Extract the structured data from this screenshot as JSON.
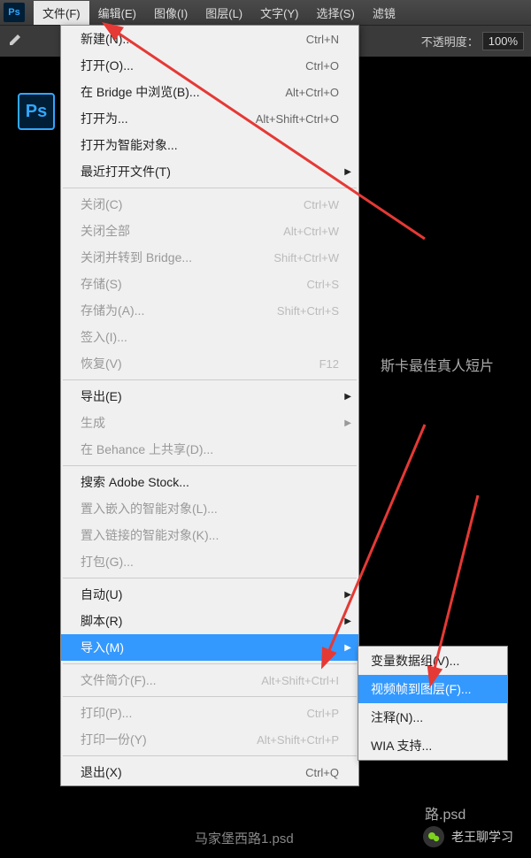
{
  "menubar": {
    "logo": "Ps",
    "items": [
      "文件(F)",
      "编辑(E)",
      "图像(I)",
      "图层(L)",
      "文字(Y)",
      "选择(S)",
      "滤镜"
    ]
  },
  "toolbar": {
    "opacity_label": "不透明度：",
    "opacity_value": "100%"
  },
  "side_logo": "Ps",
  "dropdown": [
    {
      "type": "item",
      "label": "新建(N)...",
      "shortcut": "Ctrl+N"
    },
    {
      "type": "item",
      "label": "打开(O)...",
      "shortcut": "Ctrl+O"
    },
    {
      "type": "item",
      "label": "在 Bridge 中浏览(B)...",
      "shortcut": "Alt+Ctrl+O"
    },
    {
      "type": "item",
      "label": "打开为...",
      "shortcut": "Alt+Shift+Ctrl+O"
    },
    {
      "type": "item",
      "label": "打开为智能对象..."
    },
    {
      "type": "item",
      "label": "最近打开文件(T)",
      "submenu": true
    },
    {
      "type": "sep"
    },
    {
      "type": "item",
      "label": "关闭(C)",
      "shortcut": "Ctrl+W",
      "disabled": true
    },
    {
      "type": "item",
      "label": "关闭全部",
      "shortcut": "Alt+Ctrl+W",
      "disabled": true
    },
    {
      "type": "item",
      "label": "关闭并转到 Bridge...",
      "shortcut": "Shift+Ctrl+W",
      "disabled": true
    },
    {
      "type": "item",
      "label": "存储(S)",
      "shortcut": "Ctrl+S",
      "disabled": true
    },
    {
      "type": "item",
      "label": "存储为(A)...",
      "shortcut": "Shift+Ctrl+S",
      "disabled": true
    },
    {
      "type": "item",
      "label": "签入(I)...",
      "disabled": true
    },
    {
      "type": "item",
      "label": "恢复(V)",
      "shortcut": "F12",
      "disabled": true
    },
    {
      "type": "sep"
    },
    {
      "type": "item",
      "label": "导出(E)",
      "submenu": true
    },
    {
      "type": "item",
      "label": "生成",
      "submenu": true,
      "disabled": true
    },
    {
      "type": "item",
      "label": "在 Behance 上共享(D)...",
      "disabled": true
    },
    {
      "type": "sep"
    },
    {
      "type": "item",
      "label": "搜索 Adobe Stock..."
    },
    {
      "type": "item",
      "label": "置入嵌入的智能对象(L)...",
      "disabled": true
    },
    {
      "type": "item",
      "label": "置入链接的智能对象(K)...",
      "disabled": true
    },
    {
      "type": "item",
      "label": "打包(G)...",
      "disabled": true
    },
    {
      "type": "sep"
    },
    {
      "type": "item",
      "label": "自动(U)",
      "submenu": true
    },
    {
      "type": "item",
      "label": "脚本(R)",
      "submenu": true
    },
    {
      "type": "item",
      "label": "导入(M)",
      "submenu": true,
      "highlighted": true
    },
    {
      "type": "sep"
    },
    {
      "type": "item",
      "label": "文件简介(F)...",
      "shortcut": "Alt+Shift+Ctrl+I",
      "disabled": true
    },
    {
      "type": "sep"
    },
    {
      "type": "item",
      "label": "打印(P)...",
      "shortcut": "Ctrl+P",
      "disabled": true
    },
    {
      "type": "item",
      "label": "打印一份(Y)",
      "shortcut": "Alt+Shift+Ctrl+P",
      "disabled": true
    },
    {
      "type": "sep"
    },
    {
      "type": "item",
      "label": "退出(X)",
      "shortcut": "Ctrl+Q"
    }
  ],
  "submenu": [
    {
      "label": "变量数据组(V)..."
    },
    {
      "label": "视频帧到图层(F)...",
      "highlighted": true
    },
    {
      "label": "注释(N)..."
    },
    {
      "label": "WIA 支持..."
    }
  ],
  "bg_texts": {
    "oscar": "斯卡最佳真人短片",
    "road": "路.psd",
    "tab": "马家堡西路1.psd"
  },
  "footer": {
    "text": "老王聊学习"
  }
}
